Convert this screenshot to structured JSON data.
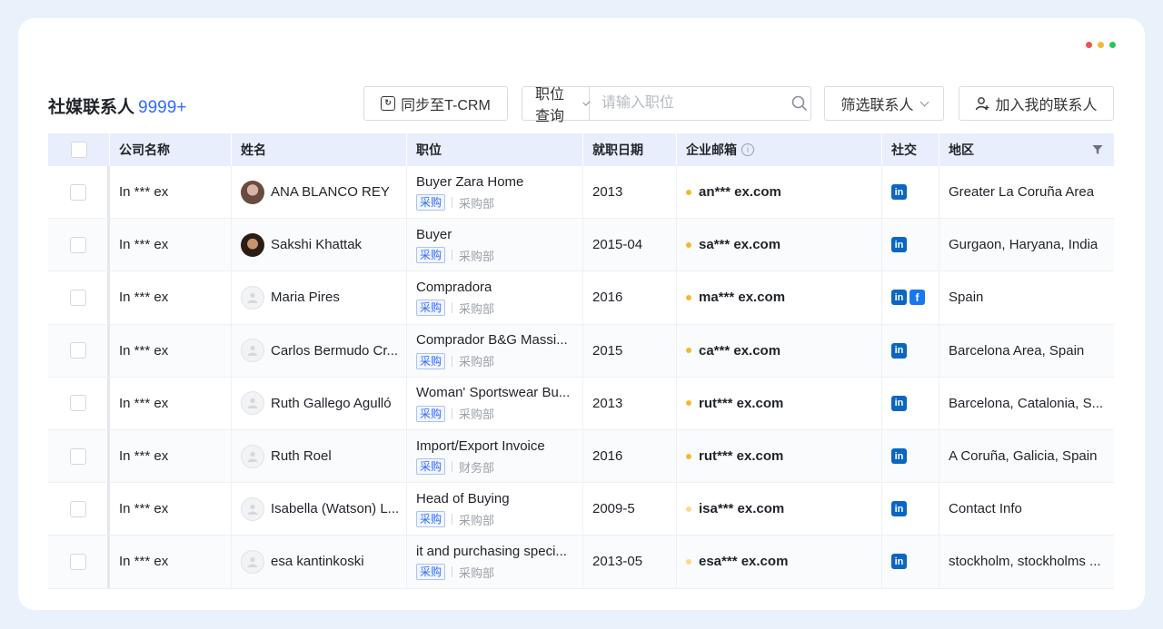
{
  "header": {
    "title": "社媒联系人",
    "count": "9999+"
  },
  "toolbar": {
    "sync_label": "同步至T-CRM",
    "position_select": "职位查询",
    "position_placeholder": "请输入职位",
    "filter_label": "筛选联系人",
    "add_label": "加入我的联系人"
  },
  "window_dots": {
    "colors": [
      "#f0524f",
      "#f5b731",
      "#2dc653"
    ]
  },
  "colors": {
    "accent": "#2f6bff",
    "linkedin": "#0a66c2",
    "facebook": "#1877f2",
    "email_dot": "#f5b731",
    "email_dot_light": "#f9d98b"
  },
  "columns": {
    "company": "公司名称",
    "name": "姓名",
    "position": "职位",
    "date": "就职日期",
    "email": "企业邮箱",
    "social": "社交",
    "region": "地区"
  },
  "rows": [
    {
      "company": "In *** ex",
      "name": "ANA BLANCO REY",
      "avatar": "photo1",
      "title": "Buyer Zara Home",
      "tag": "采购",
      "dept": "采购部",
      "date": "2013",
      "email": "an*** ex.com",
      "email_light": false,
      "social": [
        "linkedin"
      ],
      "region": "Greater La Coruña Area"
    },
    {
      "company": "In *** ex",
      "name": "Sakshi Khattak",
      "avatar": "photo2",
      "title": "Buyer",
      "tag": "采购",
      "dept": "采购部",
      "date": "2015-04",
      "email": "sa*** ex.com",
      "email_light": false,
      "social": [
        "linkedin"
      ],
      "region": "Gurgaon, Haryana, India"
    },
    {
      "company": "In *** ex",
      "name": "Maria Pires",
      "avatar": "placeholder",
      "title": "Compradora",
      "tag": "采购",
      "dept": "采购部",
      "date": "2016",
      "email": "ma*** ex.com",
      "email_light": false,
      "social": [
        "linkedin",
        "facebook"
      ],
      "region": "Spain"
    },
    {
      "company": "In *** ex",
      "name": "Carlos Bermudo Cr...",
      "avatar": "placeholder",
      "title": "Comprador B&G Massi...",
      "tag": "采购",
      "dept": "采购部",
      "date": "2015",
      "email": "ca*** ex.com",
      "email_light": false,
      "social": [
        "linkedin"
      ],
      "region": "Barcelona Area, Spain"
    },
    {
      "company": "In *** ex",
      "name": "Ruth Gallego Agulló",
      "avatar": "placeholder",
      "title": "Woman' Sportswear Bu...",
      "tag": "采购",
      "dept": "采购部",
      "date": "2013",
      "email": "rut*** ex.com",
      "email_light": false,
      "social": [
        "linkedin"
      ],
      "region": "Barcelona, Catalonia, S..."
    },
    {
      "company": "In *** ex",
      "name": "Ruth Roel",
      "avatar": "placeholder",
      "title": "Import/Export Invoice",
      "tag": "采购",
      "dept": "财务部",
      "date": "2016",
      "email": "rut*** ex.com",
      "email_light": false,
      "social": [
        "linkedin"
      ],
      "region": "A Coruña, Galicia, Spain"
    },
    {
      "company": "In *** ex",
      "name": "Isabella (Watson) L...",
      "avatar": "placeholder",
      "title": "Head of Buying",
      "tag": "采购",
      "dept": "采购部",
      "date": "2009-5",
      "email": "isa*** ex.com",
      "email_light": true,
      "social": [
        "linkedin"
      ],
      "region": "Contact Info"
    },
    {
      "company": "In *** ex",
      "name": "esa kantinkoski",
      "avatar": "placeholder",
      "title": "it and purchasing speci...",
      "tag": "采购",
      "dept": "采购部",
      "date": "2013-05",
      "email": "esa*** ex.com",
      "email_light": true,
      "social": [
        "linkedin"
      ],
      "region": "stockholm, stockholms ..."
    }
  ],
  "social_icons": {
    "linkedin": "in",
    "facebook": "f"
  }
}
